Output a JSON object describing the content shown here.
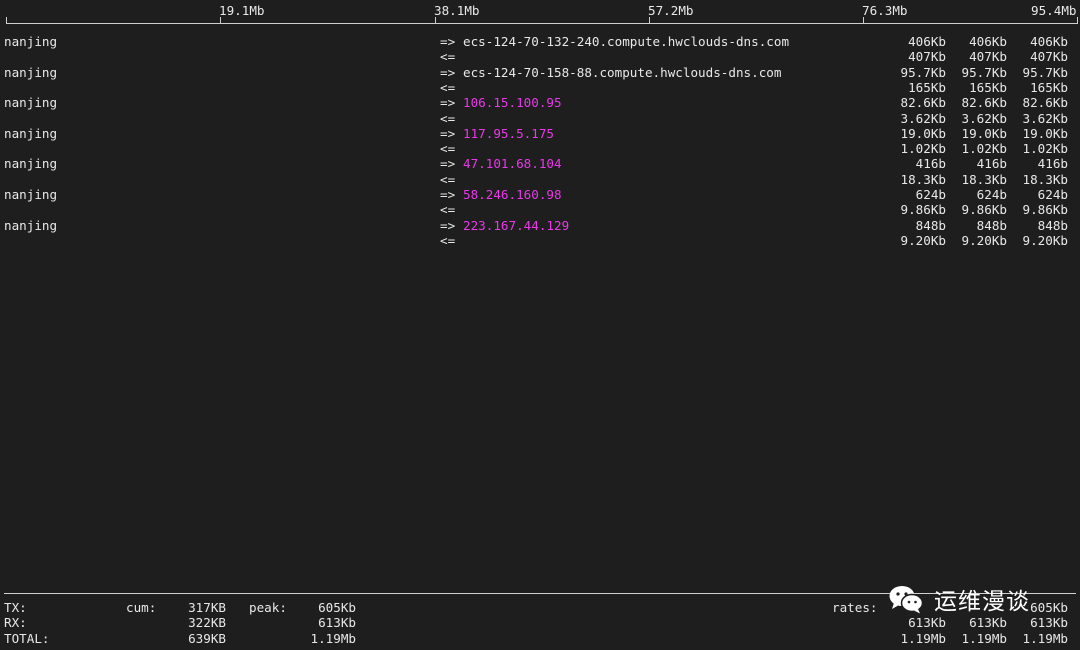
{
  "scale": {
    "labels": [
      "19.1Mb",
      "38.1Mb",
      "57.2Mb",
      "76.3Mb",
      "95.4Mb"
    ]
  },
  "flows": [
    {
      "local": "nanjing",
      "out_arrow": "=>",
      "in_arrow": "<=",
      "remote": "ecs-124-70-132-240.compute.hwclouds-dns.com",
      "remote_is_ip": false,
      "out_rates": [
        "406Kb",
        "406Kb",
        "406Kb"
      ],
      "in_rates": [
        "407Kb",
        "407Kb",
        "407Kb"
      ]
    },
    {
      "local": "nanjing",
      "out_arrow": "=>",
      "in_arrow": "<=",
      "remote": "ecs-124-70-158-88.compute.hwclouds-dns.com",
      "remote_is_ip": false,
      "out_rates": [
        "95.7Kb",
        "95.7Kb",
        "95.7Kb"
      ],
      "in_rates": [
        "165Kb",
        "165Kb",
        "165Kb"
      ]
    },
    {
      "local": "nanjing",
      "out_arrow": "=>",
      "in_arrow": "<=",
      "remote": "106.15.100.95",
      "remote_is_ip": true,
      "out_rates": [
        "82.6Kb",
        "82.6Kb",
        "82.6Kb"
      ],
      "in_rates": [
        "3.62Kb",
        "3.62Kb",
        "3.62Kb"
      ]
    },
    {
      "local": "nanjing",
      "out_arrow": "=>",
      "in_arrow": "<=",
      "remote": "117.95.5.175",
      "remote_is_ip": true,
      "out_rates": [
        "19.0Kb",
        "19.0Kb",
        "19.0Kb"
      ],
      "in_rates": [
        "1.02Kb",
        "1.02Kb",
        "1.02Kb"
      ]
    },
    {
      "local": "nanjing",
      "out_arrow": "=>",
      "in_arrow": "<=",
      "remote": "47.101.68.104",
      "remote_is_ip": true,
      "out_rates": [
        "416b",
        "416b",
        "416b"
      ],
      "in_rates": [
        "18.3Kb",
        "18.3Kb",
        "18.3Kb"
      ]
    },
    {
      "local": "nanjing",
      "out_arrow": "=>",
      "in_arrow": "<=",
      "remote": "58.246.160.98",
      "remote_is_ip": true,
      "out_rates": [
        "624b",
        "624b",
        "624b"
      ],
      "in_rates": [
        "9.86Kb",
        "9.86Kb",
        "9.86Kb"
      ]
    },
    {
      "local": "nanjing",
      "out_arrow": "=>",
      "in_arrow": "<=",
      "remote": "223.167.44.129",
      "remote_is_ip": true,
      "out_rates": [
        "848b",
        "848b",
        "848b"
      ],
      "in_rates": [
        "9.20Kb",
        "9.20Kb",
        "9.20Kb"
      ]
    }
  ],
  "summary": {
    "tx": {
      "label": "TX:",
      "cum_label": "cum:",
      "cum": "317KB",
      "peak_label": "peak:",
      "peak": "605Kb",
      "rates_label": "rates:",
      "rates": [
        "",
        "",
        "605Kb"
      ]
    },
    "rx": {
      "label": "RX:",
      "cum": "322KB",
      "peak": "613Kb",
      "rates": [
        "613Kb",
        "613Kb",
        "613Kb"
      ]
    },
    "total": {
      "label": "TOTAL:",
      "cum": "639KB",
      "peak": "1.19Mb",
      "rates": [
        "1.19Mb",
        "1.19Mb",
        "1.19Mb"
      ]
    }
  },
  "watermark": {
    "text": "运维漫谈",
    "icon": "wechat-icon"
  }
}
